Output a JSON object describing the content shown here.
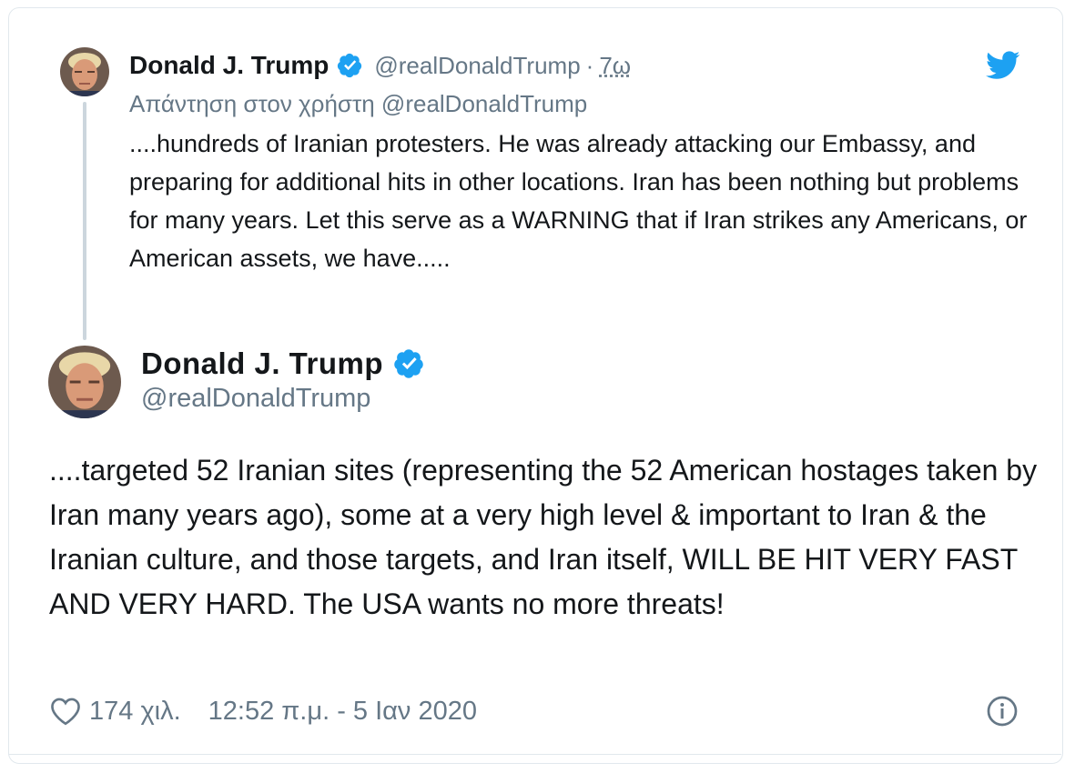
{
  "parent_tweet": {
    "author_name": "Donald J. Trump",
    "handle": "@realDonaldTrump",
    "separator": "·",
    "time": "7ω",
    "reply_to": "Απάντηση στον χρήστη @realDonaldTrump",
    "text": "....hundreds of Iranian protesters. He was already attacking our Embassy, and preparing for additional hits in other locations. Iran has been nothing but problems for many years. Let this serve as a WARNING that if Iran strikes any Americans, or American assets, we have....."
  },
  "main_tweet": {
    "author_name": "Donald J. Trump",
    "handle": "@realDonaldTrump",
    "text": "....targeted 52 Iranian sites (representing the 52 American hostages taken by Iran many years ago), some at a very high level & important to Iran &  the Iranian culture, and those targets, and Iran itself, WILL BE HIT VERY FAST AND VERY HARD. The USA wants no more threats!",
    "likes": "174 χιλ.",
    "timestamp": "12:52 π.μ. - 5 Ιαν 2020"
  },
  "icons": {
    "brand": "twitter-bird-icon",
    "verified": "verified-badge-icon",
    "like": "heart-icon",
    "info": "info-icon"
  },
  "colors": {
    "twitter_blue": "#1da1f2",
    "text": "#14171a",
    "muted": "#657786",
    "border": "#e1e8ed",
    "thread_line": "#ccd6dd"
  }
}
